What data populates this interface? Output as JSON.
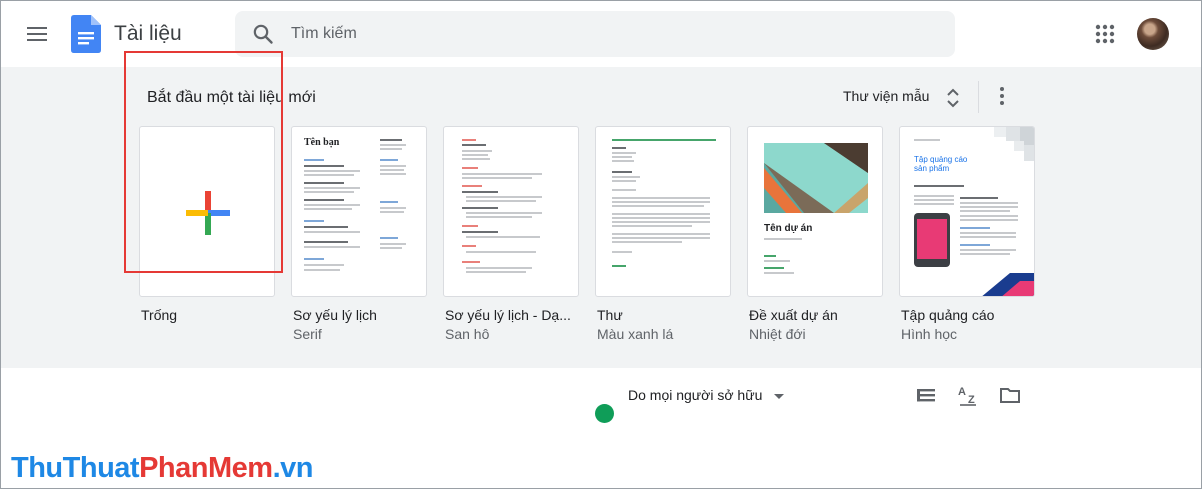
{
  "header": {
    "app_title": "Tài liệu",
    "search_placeholder": "Tìm kiếm"
  },
  "templates": {
    "section_title": "Bắt đầu một tài liệu mới",
    "gallery_label": "Thư viện mẫu",
    "items": [
      {
        "name": "Trống",
        "subtitle": ""
      },
      {
        "name": "Sơ yếu lý lịch",
        "subtitle": "Serif",
        "thumb_heading": "Tên bạn"
      },
      {
        "name": "Sơ yếu lý lịch - Dạ...",
        "subtitle": "San hô"
      },
      {
        "name": "Thư",
        "subtitle": "Màu xanh lá"
      },
      {
        "name": "Đề xuất dự án",
        "subtitle": "Nhiệt đới",
        "thumb_heading": "Tên dự án"
      },
      {
        "name": "Tập quảng cáo",
        "subtitle": "Hình học",
        "thumb_heading": "Tập quảng cáo sản phẩm"
      }
    ]
  },
  "docs_list": {
    "owner_filter": "Do mọi người sở hữu"
  },
  "watermark": {
    "part1": "ThuThuat",
    "part2": "PhanMem",
    "part3": ".vn"
  },
  "colors": {
    "docs_blue": "#4285f4",
    "highlight_red": "#e53935",
    "band_bg": "#f1f3f4",
    "status_green": "#0f9d58"
  }
}
